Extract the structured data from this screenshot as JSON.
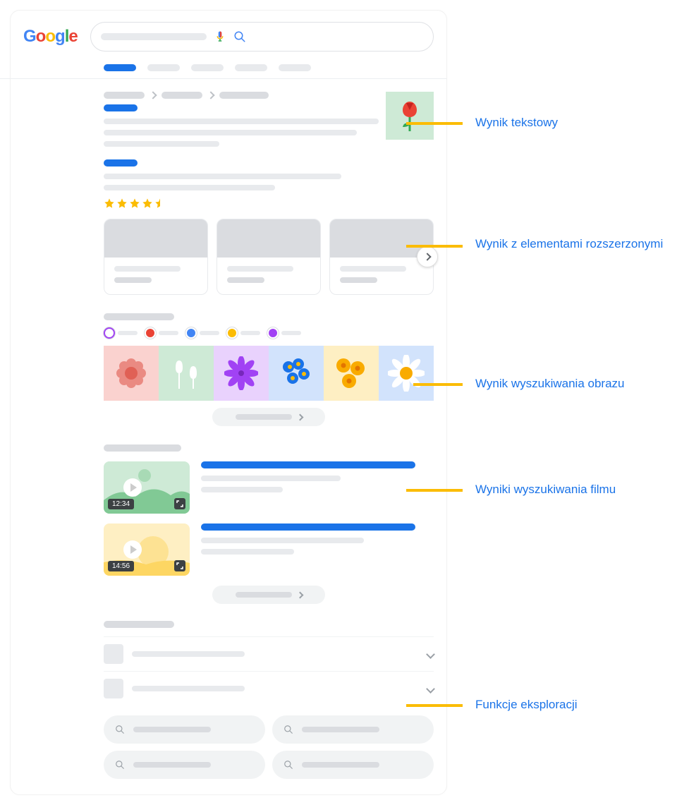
{
  "logo": {
    "g1": "G",
    "o1": "o",
    "o2": "o",
    "g2": "g",
    "l": "l",
    "e": "e"
  },
  "annotations": {
    "text_result": "Wynik tekstowy",
    "rich_result": "Wynik z elementami rozszerzonymi",
    "image_result": "Wynik wyszukiwania obrazu",
    "video_result": "Wyniki wyszukiwania filmu",
    "exploration": "Funkcje eksploracji"
  },
  "videos": {
    "v1_duration": "12:34",
    "v2_duration": "14:56"
  },
  "star_rating": 4.5
}
